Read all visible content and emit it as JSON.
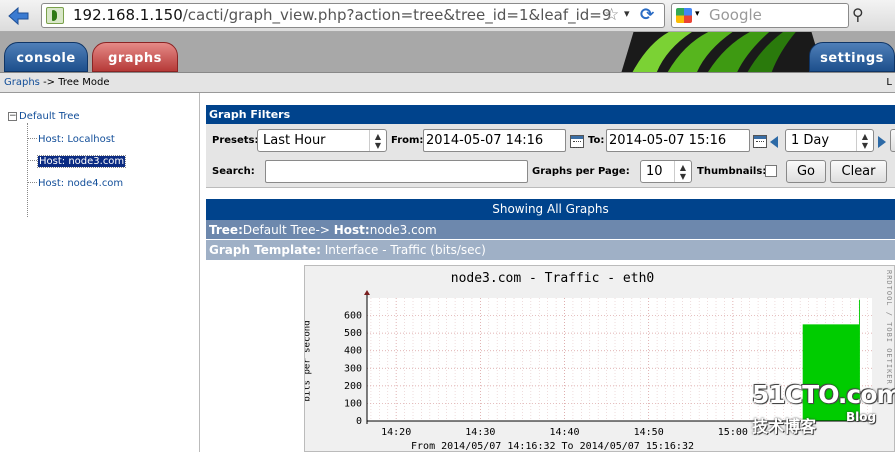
{
  "browser": {
    "url_host": "192.168.1.150",
    "url_path": "/cacti/graph_view.php?action=tree&tree_id=1&leaf_id=9",
    "search_placeholder": "Google",
    "icons": [
      "back-arrow-icon",
      "site-icon",
      "star-icon",
      "dropdown-icon",
      "reload-icon",
      "google-icon",
      "binoculars-icon"
    ]
  },
  "header": {
    "tabs": [
      {
        "label": "console"
      },
      {
        "label": "graphs"
      },
      {
        "label": "settings"
      }
    ]
  },
  "breadcrumb": {
    "link": "Graphs",
    "rest": "-> Tree Mode",
    "right": "L"
  },
  "tree": {
    "root": "Default Tree",
    "items": [
      {
        "label": "Host: Localhost"
      },
      {
        "label": "Host: node3.com"
      },
      {
        "label": "Host: node4.com"
      }
    ],
    "selected_index": 1
  },
  "filters": {
    "title": "Graph Filters",
    "presets_label": "Presets:",
    "presets_value": "Last Hour",
    "from_label": "From:",
    "from_value": "2014-05-07 14:16",
    "to_label": "To:",
    "to_value": "2014-05-07 15:16",
    "span_value": "1 Day",
    "search_label": "Search:",
    "search_value": "",
    "per_page_label": "Graphs per Page:",
    "per_page_value": "10",
    "thumbnails_label": "Thumbnails:",
    "thumbnails_checked": false,
    "go_label": "Go",
    "clear_label": "Clear"
  },
  "listing": {
    "showing": "Showing All Graphs",
    "tree_key": "Tree:",
    "tree_val": "Default Tree->",
    "host_key": "Host:",
    "host_val": "node3.com",
    "template_key": "Graph Template:",
    "template_val": "Interface - Traffic (bits/sec)"
  },
  "chart_data": {
    "type": "area",
    "title": "node3.com - Traffic - eth0",
    "ylabel": "bits per second",
    "xlabel": "",
    "side_text": "RRDTOOL / TOBI OETIKER",
    "footer": "From 2014/05/07 14:16:32 To 2014/05/07 15:16:32",
    "ylim": [
      0,
      700
    ],
    "yticks": [
      0,
      100,
      200,
      300,
      400,
      500,
      600
    ],
    "xticks": [
      "14:20",
      "14:30",
      "14:40",
      "14:50",
      "15:00"
    ],
    "x_range_minutes": [
      "14:16:32",
      "15:16:32"
    ],
    "series": [
      {
        "color": "#00cc00",
        "points": [
          {
            "x": "15:10",
            "y": 550
          },
          {
            "x": "15:15",
            "y": 690
          }
        ]
      }
    ]
  },
  "watermark": {
    "big": "51CTO.com",
    "cn": "技术博客",
    "blog": "Blog"
  }
}
